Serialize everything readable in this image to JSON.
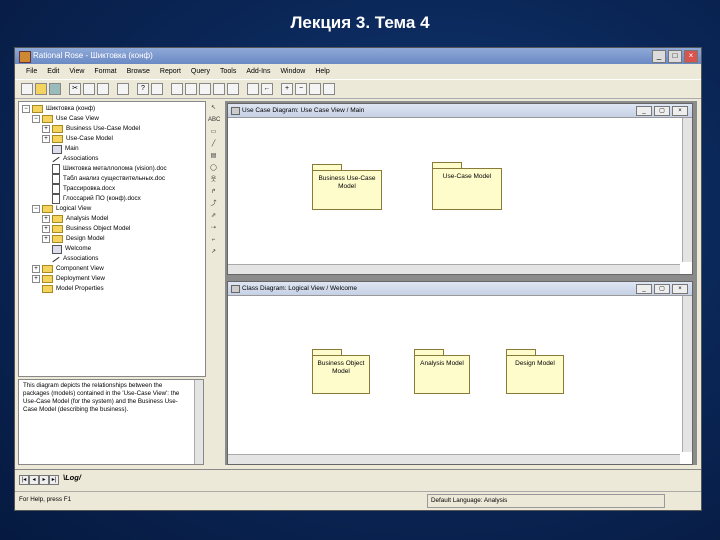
{
  "slide": {
    "title": "Лекция 3. Тема 4"
  },
  "window": {
    "title": "Rational Rose - Шиктовка (конф)"
  },
  "menu": [
    "File",
    "Edit",
    "View",
    "Format",
    "Browse",
    "Report",
    "Query",
    "Tools",
    "Add-Ins",
    "Window",
    "Help"
  ],
  "tree": {
    "root": "Шиктовка (конф)",
    "use_case_view": "Use Case View",
    "business_use_case_model": "Business Use-Case Model",
    "use_case_model": "Use-Case Model",
    "main": "Main",
    "associations_1": "Associations",
    "doc_1": "Шиктовка металлолома (vision).doc",
    "doc_2": "Табл анализ существительных.doc",
    "doc_3": "Трассировка.docx",
    "doc_4": "Глоссарий ПО (конф).docx",
    "logical_view": "Logical View",
    "analysis_model": "Analysis Model",
    "business_object_model": "Business Object Model",
    "design_model": "Design Model",
    "welcome": "Welcome",
    "associations_2": "Associations",
    "component_view": "Component View",
    "deployment_view": "Deployment View",
    "model_properties": "Model Properties"
  },
  "documentation": "This diagram depicts the relationships between the packages (models) contained in the 'Use-Case View': the Use-Case Model (for the system) and the Business Use-Case Model (describing the business).",
  "use_case_window": {
    "title": "Use Case Diagram: Use Case View / Main",
    "packages": [
      "Business Use-Case Model",
      "Use-Case Model"
    ]
  },
  "class_window": {
    "title": "Class Diagram: Logical View / Welcome",
    "packages": [
      "Business Object Model",
      "Analysis Model",
      "Design Model"
    ]
  },
  "log_tab": "Log",
  "status": {
    "help": "For Help, press F1",
    "language": "Default Language: Analysis"
  }
}
